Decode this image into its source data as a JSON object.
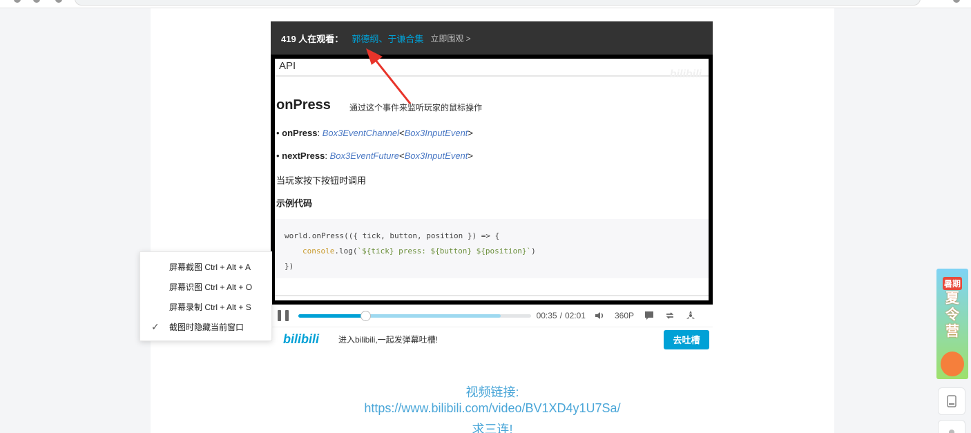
{
  "player": {
    "viewer_count": "419 人在观看：",
    "collection_link": "郭德纲、于谦合集",
    "watch_now": "立即围观 >"
  },
  "video": {
    "api_title": "API",
    "watermark": "bilibili",
    "method_title": "onPress",
    "method_desc": "通过这个事件来监听玩家的鼠标操作",
    "props": [
      {
        "bullet": "• ",
        "name": "onPress",
        "colon": ": ",
        "type1": "Box3EventChannel",
        "lt": "<",
        "type2": "Box3InputEvent",
        "gt": ">"
      },
      {
        "bullet": "• ",
        "name": "nextPress",
        "colon": ": ",
        "type1": "Box3EventFuture",
        "lt": "<",
        "type2": "Box3InputEvent",
        "gt": ">"
      }
    ],
    "trigger_text": "当玩家按下按钮时调用",
    "example_heading": "示例代码",
    "code_line1": "world.onPress(({ tick, button, position }) => {",
    "code_line2_fn": "console",
    "code_line2_mid": ".log(",
    "code_line2_str": "`${tick} press: ${button} ${position}`",
    "code_line2_end": ")",
    "code_line3": "})"
  },
  "controls": {
    "progress_fraction": 0.29,
    "buffer_fraction": 0.87,
    "time_current": "00:35",
    "time_sep": "/",
    "time_total": "02:01",
    "quality": "360P"
  },
  "danmaku": {
    "logo": "bilibili",
    "prompt": "进入bilibili,一起发弹幕吐槽!",
    "send_label": "去吐槽"
  },
  "context_menu": {
    "items": [
      {
        "label": "屏幕截图 Ctrl + Alt + A",
        "check": ""
      },
      {
        "label": "屏幕识图 Ctrl + Alt + O",
        "check": ""
      },
      {
        "label": "屏幕录制 Ctrl + Alt + S",
        "check": ""
      },
      {
        "label": "截图时隐藏当前窗口",
        "check": "✓"
      }
    ]
  },
  "caption": {
    "line1": "视频链接:",
    "line2": "https://www.bilibili.com/video/BV1XD4y1U7Sa/",
    "line3": "求三连!"
  },
  "side": {
    "banner_tag": "暑期",
    "banner_title": "夏令营"
  },
  "colors": {
    "accent": "#00a1d6",
    "arrow": "#e8342a",
    "caption": "#4aa6d8"
  }
}
